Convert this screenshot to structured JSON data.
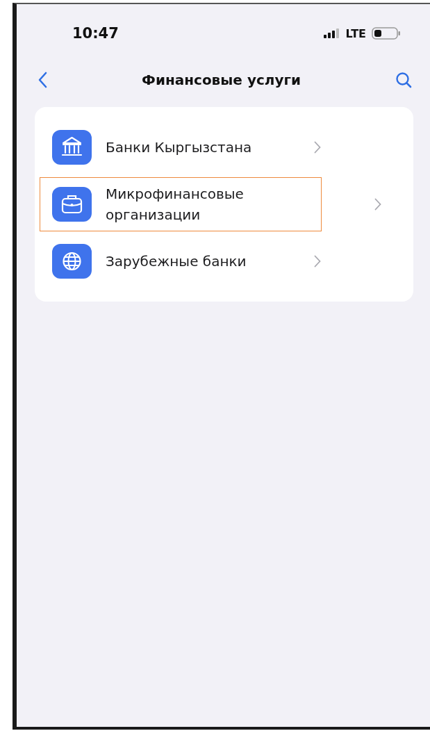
{
  "status_bar": {
    "time": "10:47",
    "network": "LTE"
  },
  "nav": {
    "title": "Финансовые услуги"
  },
  "items": [
    {
      "label": "Банки Кыргызстана",
      "highlighted": false
    },
    {
      "label": "Микрофинансовые организации",
      "highlighted": true
    },
    {
      "label": "Зарубежные банки",
      "highlighted": false
    }
  ]
}
